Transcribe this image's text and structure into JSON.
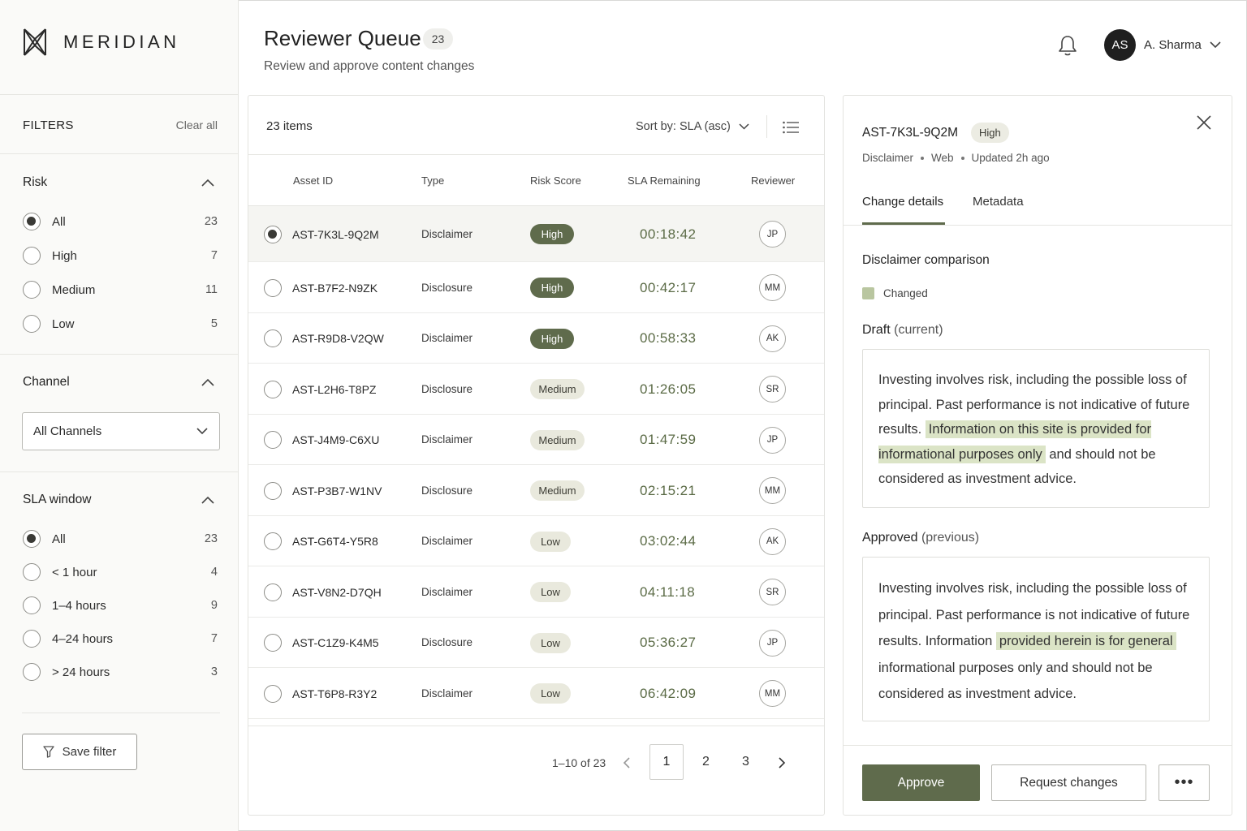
{
  "brand": {
    "name": "MERIDIAN",
    "logo_icon": "meridian-logo-icon"
  },
  "header": {
    "title": "Reviewer Queue",
    "count": "23",
    "subtitle": "Review and approve content changes",
    "user": {
      "initials": "AS",
      "name": "A. Sharma"
    }
  },
  "filters": {
    "title": "FILTERS",
    "clear_label": "Clear all",
    "risk": {
      "title": "Risk",
      "options": [
        {
          "label": "All",
          "count": "23",
          "selected": true
        },
        {
          "label": "High",
          "count": "7",
          "selected": false
        },
        {
          "label": "Medium",
          "count": "11",
          "selected": false
        },
        {
          "label": "Low",
          "count": "5",
          "selected": false
        }
      ]
    },
    "channel": {
      "title": "Channel",
      "value": "All Channels"
    },
    "sla": {
      "title": "SLA window",
      "options": [
        {
          "label": "All",
          "count": "23",
          "selected": true
        },
        {
          "label": "< 1 hour",
          "count": "4",
          "selected": false
        },
        {
          "label": "1–4 hours",
          "count": "9",
          "selected": false
        },
        {
          "label": "4–24 hours",
          "count": "7",
          "selected": false
        },
        {
          "label": "> 24 hours",
          "count": "3",
          "selected": false
        }
      ]
    },
    "save_label": "Save filter"
  },
  "table": {
    "items_label": "23 items",
    "sort_label": "Sort by: SLA (asc)",
    "columns": [
      "Asset ID",
      "Type",
      "Risk Score",
      "SLA Remaining",
      "Reviewer"
    ],
    "rows": [
      {
        "id": "AST-7K3L-9Q2M",
        "type": "Disclaimer",
        "risk": "High",
        "sla": "00:18:42",
        "reviewer": "JP",
        "selected": true
      },
      {
        "id": "AST-B7F2-N9ZK",
        "type": "Disclosure",
        "risk": "High",
        "sla": "00:42:17",
        "reviewer": "MM",
        "selected": false
      },
      {
        "id": "AST-R9D8-V2QW",
        "type": "Disclaimer",
        "risk": "High",
        "sla": "00:58:33",
        "reviewer": "AK",
        "selected": false
      },
      {
        "id": "AST-L2H6-T8PZ",
        "type": "Disclosure",
        "risk": "Medium",
        "sla": "01:26:05",
        "reviewer": "SR",
        "selected": false
      },
      {
        "id": "AST-J4M9-C6XU",
        "type": "Disclaimer",
        "risk": "Medium",
        "sla": "01:47:59",
        "reviewer": "JP",
        "selected": false
      },
      {
        "id": "AST-P3B7-W1NV",
        "type": "Disclosure",
        "risk": "Medium",
        "sla": "02:15:21",
        "reviewer": "MM",
        "selected": false
      },
      {
        "id": "AST-G6T4-Y5R8",
        "type": "Disclaimer",
        "risk": "Low",
        "sla": "03:02:44",
        "reviewer": "AK",
        "selected": false
      },
      {
        "id": "AST-V8N2-D7QH",
        "type": "Disclaimer",
        "risk": "Low",
        "sla": "04:11:18",
        "reviewer": "SR",
        "selected": false
      },
      {
        "id": "AST-C1Z9-K4M5",
        "type": "Disclosure",
        "risk": "Low",
        "sla": "05:36:27",
        "reviewer": "JP",
        "selected": false
      },
      {
        "id": "AST-T6P8-R3Y2",
        "type": "Disclaimer",
        "risk": "Low",
        "sla": "06:42:09",
        "reviewer": "MM",
        "selected": false
      }
    ],
    "pagination": {
      "range": "1–10 of 23",
      "pages": [
        "1",
        "2",
        "3"
      ],
      "current": "1"
    }
  },
  "detail": {
    "asset_id": "AST-7K3L-9Q2M",
    "risk": "High",
    "meta": [
      "Disclaimer",
      "Web",
      "Updated 2h ago"
    ],
    "tabs": [
      "Change details",
      "Metadata"
    ],
    "section_title": "Disclaimer comparison",
    "legend_label": "Changed",
    "draft": {
      "label": "Draft",
      "sublabel": "(current)",
      "text_before": "Investing involves risk, including the possible loss of principal. Past performance is not indicative of future results. ",
      "text_highlight": "Information on this site is provided for informational purposes only",
      "text_after": " and should not be considered as investment advice."
    },
    "approved": {
      "label": "Approved",
      "sublabel": "(previous)",
      "text_before": "Investing involves risk, including the possible loss of principal. Past performance is not indicative of future results. Information ",
      "text_highlight": "provided herein is for general",
      "text_after": " informational purposes only and should not be considered as investment advice."
    },
    "actions": {
      "approve": "Approve",
      "request": "Request changes",
      "more": "•••"
    }
  },
  "colors": {
    "accent": "#5f6b4c",
    "highlight": "#dbe4c6",
    "sla_text": "#5b6b46",
    "medium_low_badge": "#e9e9dd"
  }
}
